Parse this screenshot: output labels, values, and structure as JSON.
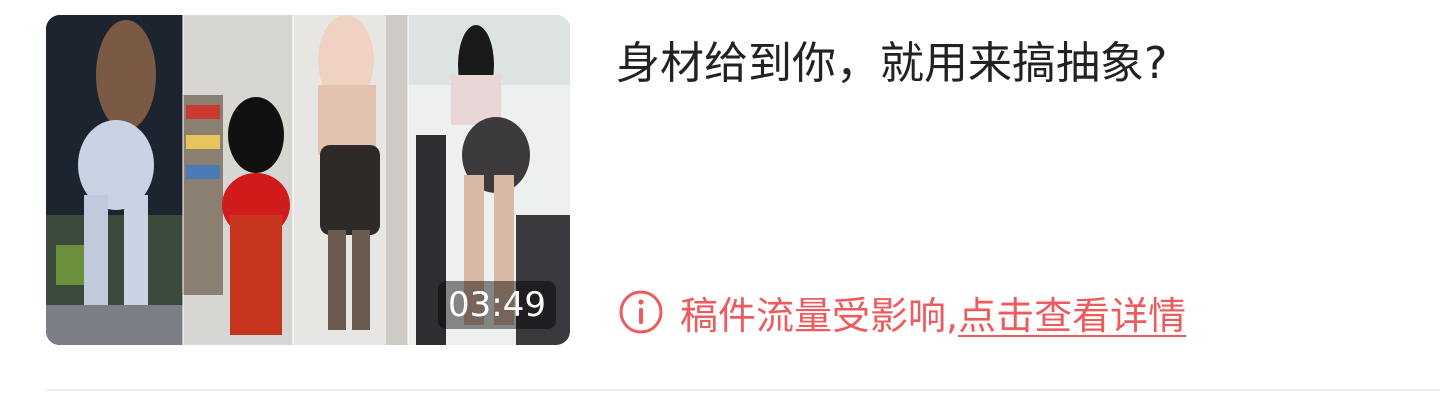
{
  "video": {
    "title": "身材给到你，就用来搞抽象?",
    "duration": "03:49",
    "warning_text": "稿件流量受影响,",
    "warning_link": "点击查看详情"
  },
  "colors": {
    "warning": "#ee5b5f",
    "title": "#222222",
    "divider": "#eeeeee"
  },
  "icons": {
    "warning": "info-circle-icon"
  }
}
